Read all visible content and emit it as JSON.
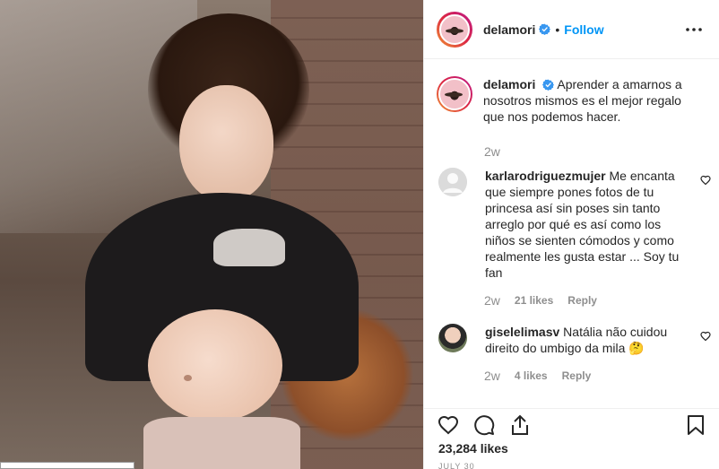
{
  "post": {
    "author": "delamori",
    "follow_label": "Follow",
    "separator": "•",
    "more_icon": "more-horizontal-icon"
  },
  "caption": {
    "username": "delamori",
    "text": "Aprender a amarnos a nosotros mismos es el mejor regalo que nos podemos hacer.",
    "time": "2w"
  },
  "comments": [
    {
      "username": "karlarodriguezmujer",
      "text": "Me encanta que siempre pones fotos de tu princesa así sin poses sin tanto arreglo por qué es así como los niños se sienten cómodos y como realmente les gusta estar ... Soy tu fan",
      "time": "2w",
      "likes": "21 likes",
      "reply": "Reply"
    },
    {
      "username": "giselelimasv",
      "text": "Natália não cuidou direito do umbigo da mila 🤔",
      "time": "2w",
      "likes": "4 likes",
      "reply": "Reply"
    }
  ],
  "likes_count": "23,284 likes",
  "date_partial": "JULY 30",
  "colors": {
    "accent": "#0095f6",
    "text": "#262626",
    "muted": "#8e8e8e"
  }
}
